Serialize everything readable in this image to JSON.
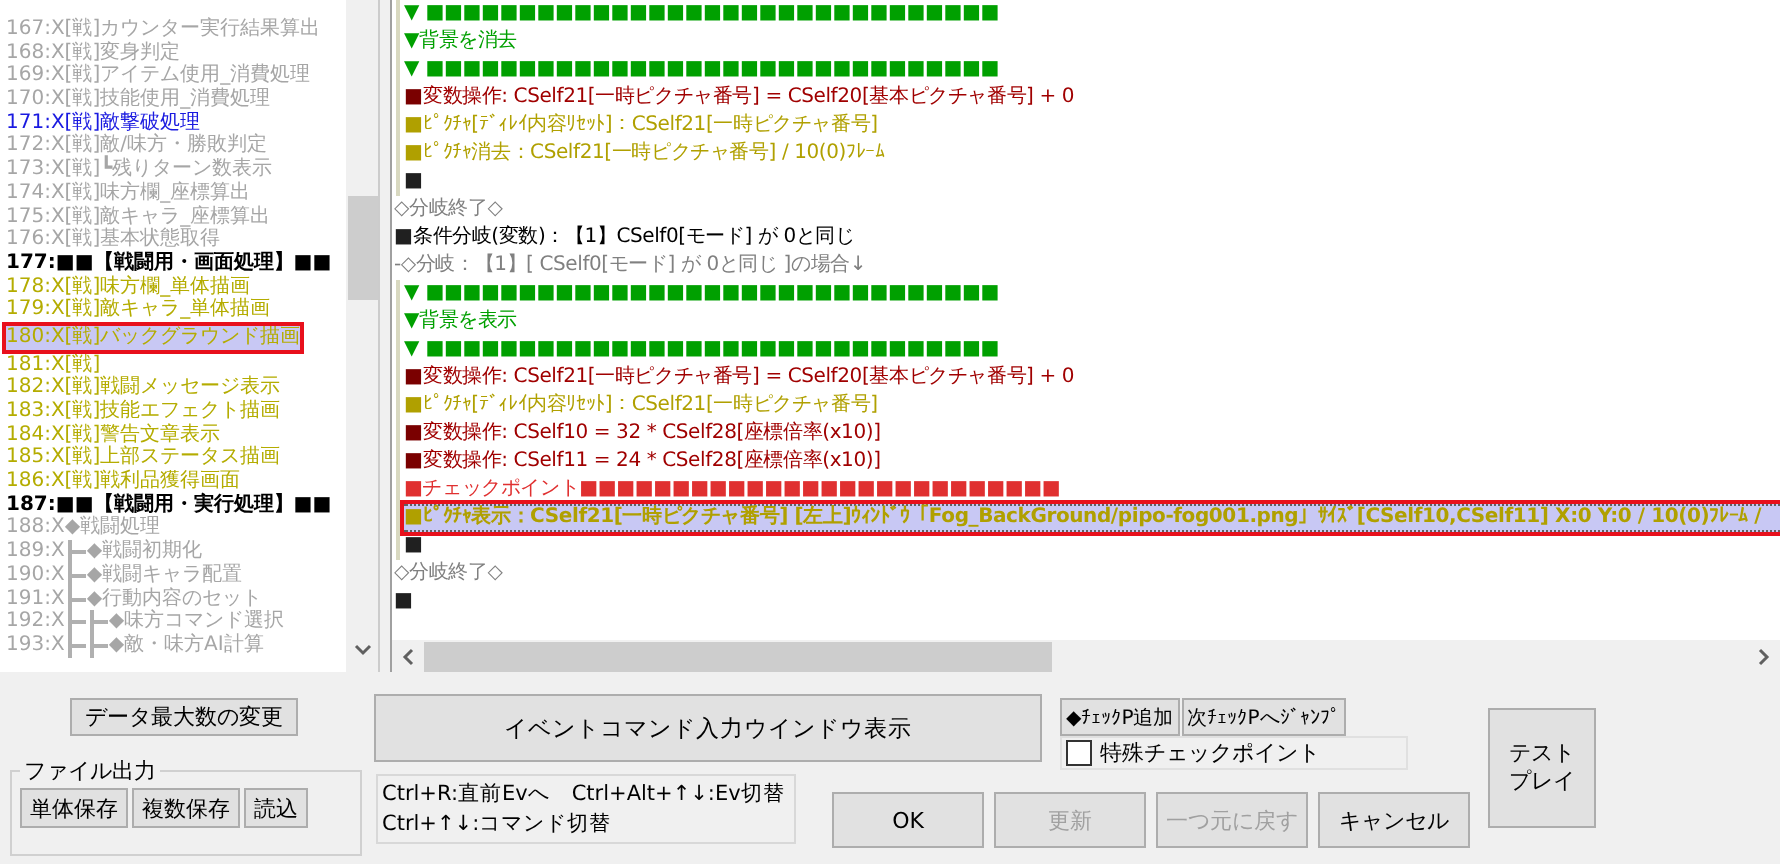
{
  "event_list": {
    "items": [
      {
        "label": "167:X[戦]カウンター実行結果算出",
        "kind": "inactive",
        "selected": false
      },
      {
        "label": "168:X[戦]変身判定",
        "kind": "inactive",
        "selected": false
      },
      {
        "label": "169:X[戦]アイテム使用_消費処理",
        "kind": "inactive",
        "selected": false
      },
      {
        "label": "170:X[戦]技能使用_消費処理",
        "kind": "inactive",
        "selected": false
      },
      {
        "label": "171:X[戦]敵撃破処理",
        "kind": "current",
        "selected": false
      },
      {
        "label": "172:X[戦]敵/味方・勝敗判定",
        "kind": "inactive",
        "selected": false
      },
      {
        "label": "173:X[戦]┗残りターン数表示",
        "kind": "inactive",
        "selected": false
      },
      {
        "label": "174:X[戦]味方欄_座標算出",
        "kind": "inactive",
        "selected": false
      },
      {
        "label": "175:X[戦]敵キャラ_座標算出",
        "kind": "inactive",
        "selected": false
      },
      {
        "label": "176:X[戦]基本状態取得",
        "kind": "inactive",
        "selected": false
      },
      {
        "label": "177:■■【戦闘用・画面処理】■■",
        "kind": "header",
        "selected": false
      },
      {
        "label": "178:X[戦]味方欄_単体描画",
        "kind": "common",
        "selected": false
      },
      {
        "label": "179:X[戦]敵キャラ_単体描画",
        "kind": "common",
        "selected": false
      },
      {
        "label": "180:X[戦]バックグラウンド描画",
        "kind": "common",
        "selected": true
      },
      {
        "label": "181:X[戦]",
        "kind": "common",
        "selected": false
      },
      {
        "label": "182:X[戦]戦闘メッセージ表示",
        "kind": "common",
        "selected": false
      },
      {
        "label": "183:X[戦]技能エフェクト描画",
        "kind": "common",
        "selected": false
      },
      {
        "label": "184:X[戦]警告文章表示",
        "kind": "common",
        "selected": false
      },
      {
        "label": "185:X[戦]上部ステータス描画",
        "kind": "common",
        "selected": false
      },
      {
        "label": "186:X[戦]戦利品獲得画面",
        "kind": "common",
        "selected": false
      },
      {
        "label": "187:■■【戦闘用・実行処理】■■",
        "kind": "header",
        "selected": false
      },
      {
        "number": "188:X",
        "label": "◆戦闘処理",
        "kind": "inactive",
        "selected": false,
        "children": [
          {
            "number": "189:X",
            "label": "◆戦闘初期化",
            "kind": "inactive",
            "selected": false
          },
          {
            "number": "190:X",
            "label": "◆戦闘キャラ配置",
            "kind": "inactive",
            "selected": false
          },
          {
            "number": "191:X",
            "label": "◆行動内容のセット",
            "kind": "inactive",
            "selected": false,
            "children": [
              {
                "number": "192:X",
                "label": "◆味方コマンド選択",
                "kind": "inactive",
                "selected": false
              },
              {
                "number": "193:X",
                "label": "◆敵・味方AI計算",
                "kind": "inactive",
                "selected": false
              }
            ]
          }
        ]
      }
    ]
  },
  "commands": [
    {
      "kind": "block",
      "children": [
        {
          "kind": "header-bar",
          "text": "▼ ■■■■■■■■■■■■■■■■■■■■■■■■■■■■■■■",
          "selected": false
        },
        {
          "kind": "comment",
          "text": "▼背景を消去",
          "selected": false
        },
        {
          "kind": "header-bar",
          "text": "▼ ■■■■■■■■■■■■■■■■■■■■■■■■■■■■■■■",
          "selected": false
        },
        {
          "kind": "variable",
          "marker": "■",
          "text": "変数操作: CSelf21[一時ピクチャ番号] = CSelf20[基本ピクチャ番号] + 0",
          "selected": false
        },
        {
          "kind": "picture",
          "marker": "■",
          "text": "ﾋﾟｸﾁｬ[ﾃﾞｨﾚｲ内容ﾘｾｯﾄ]：CSelf21[一時ピクチャ番号]",
          "selected": false
        },
        {
          "kind": "picture",
          "marker": "■",
          "text": "ﾋﾟｸﾁｬ消去：CSelf21[一時ピクチャ番号]  / 10(0)ﾌﾚｰﾑ",
          "selected": false
        },
        {
          "kind": "empty",
          "marker": "■",
          "selected": false
        }
      ]
    },
    {
      "kind": "branch-end",
      "text": "◇分岐終了◇",
      "selected": false
    },
    {
      "kind": "condition",
      "marker": "■",
      "text": "条件分岐(変数)：【1】CSelf0[モード] が 0と同じ",
      "selected": false
    },
    {
      "kind": "case",
      "text": "-◇分岐：【1】[ CSelf0[モード] が 0と同じ ]の場合↓",
      "selected": false,
      "children": [
        {
          "kind": "header-bar",
          "text": "▼ ■■■■■■■■■■■■■■■■■■■■■■■■■■■■■■■",
          "selected": false
        },
        {
          "kind": "comment",
          "text": "▼背景を表示",
          "selected": false
        },
        {
          "kind": "header-bar",
          "text": "▼ ■■■■■■■■■■■■■■■■■■■■■■■■■■■■■■■",
          "selected": false
        },
        {
          "kind": "variable",
          "marker": "■",
          "text": "変数操作: CSelf21[一時ピクチャ番号] = CSelf20[基本ピクチャ番号] + 0",
          "selected": false
        },
        {
          "kind": "picture",
          "marker": "■",
          "text": "ﾋﾟｸﾁｬ[ﾃﾞｨﾚｲ内容ﾘｾｯﾄ]：CSelf21[一時ピクチャ番号]",
          "selected": false
        },
        {
          "kind": "variable",
          "marker": "■",
          "text": "変数操作: CSelf10 = 32 * CSelf28[座標倍率(x10)]",
          "selected": false
        },
        {
          "kind": "variable",
          "marker": "■",
          "text": "変数操作: CSelf11 = 24 * CSelf28[座標倍率(x10)]",
          "selected": false
        },
        {
          "kind": "checkpoint",
          "text": "■チェックポイント■■■■■■■■■■■■■■■■■■■■■■■■■■",
          "selected": false
        },
        {
          "kind": "picture",
          "marker": "■",
          "text": "ﾋﾟｸﾁｬ表示：CSelf21[一時ピクチャ番号] [左上]ｳｨﾝﾄﾞｳ「Fog_BackGround/pipo-fog001.png」ｻｲｽﾞ[CSelf10,CSelf11] X:0 Y:0 / 10(0)ﾌﾚｰﾑ /",
          "selected": true
        },
        {
          "kind": "empty",
          "marker": "■",
          "selected": false
        }
      ]
    },
    {
      "kind": "branch-end",
      "text": "◇分岐終了◇",
      "selected": false
    },
    {
      "kind": "empty",
      "marker": "■",
      "selected": false
    }
  ],
  "buttons": {
    "max_data": "データ最大数の変更",
    "file_output": {
      "legend": "ファイル出力",
      "buttons": [
        {
          "label": "単体保存"
        },
        {
          "label": "複数保存"
        },
        {
          "label": "読込"
        }
      ]
    },
    "command_window": "イベントコマンド入力ウインドウ表示",
    "help_lines": [
      "Ctrl+R:直前Evへ　Ctrl+Alt+↑↓:Ev切替",
      "Ctrl+↑↓:コマンド切替"
    ],
    "checkpoint_add": "◆ﾁｪｯｸP追加",
    "checkpoint_jump": "次ﾁｪｯｸPへｼﾞｬﾝﾌﾟ",
    "special_checkpoint": {
      "label": "特殊チェックポイント",
      "checked": false
    },
    "actions": [
      {
        "label": "OK",
        "disabled": false
      },
      {
        "label": "更新",
        "disabled": true
      },
      {
        "label": "一つ元に戻す",
        "disabled": true
      },
      {
        "label": "キャンセル",
        "disabled": false
      }
    ],
    "test_play": [
      "テスト",
      "プレイ"
    ]
  }
}
